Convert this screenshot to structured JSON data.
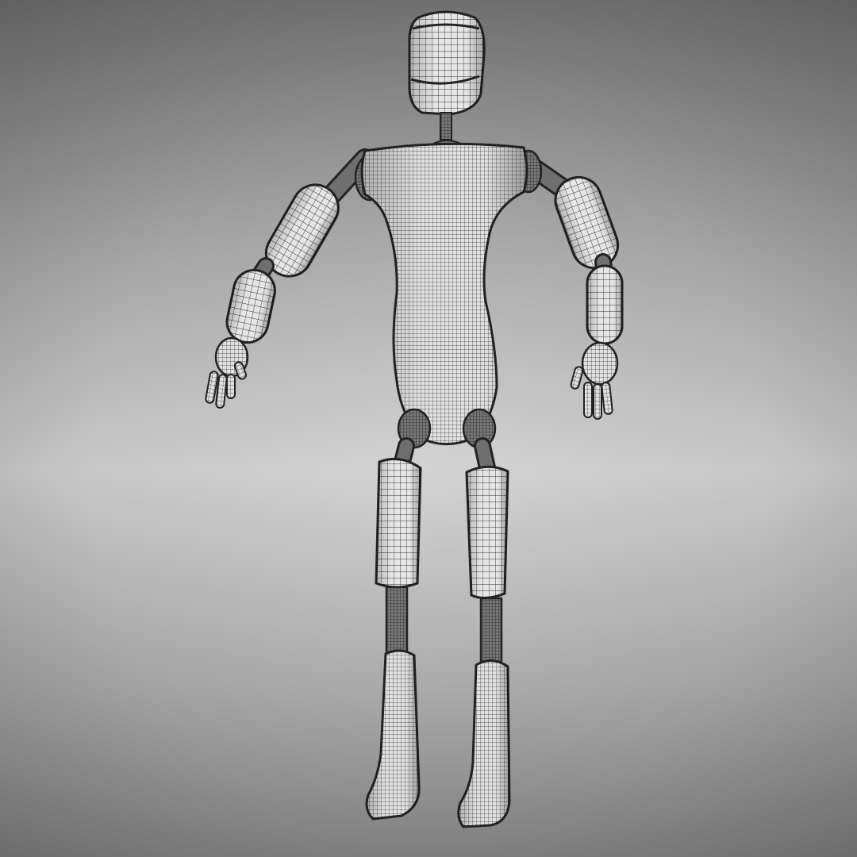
{
  "scene": {
    "subject": "wireframe-humanoid-robot",
    "background_top": "#767676",
    "background_mid": "#c9c9c9",
    "background_bottom": "#7f7f7f",
    "mesh_fill": "#e6e6e6",
    "mesh_line": "#2f2f2f",
    "joint_fill": "#6a6a6a"
  }
}
